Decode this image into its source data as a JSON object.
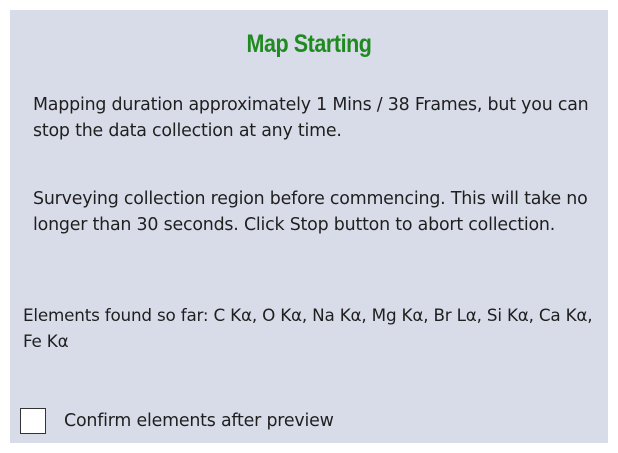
{
  "dialog": {
    "title": "Map Starting",
    "duration_text": "Mapping duration approximately 1 Mins  / 38 Frames, but you can stop the data collection at any time.",
    "survey_text": "Surveying collection region before commencing. This will take no longer than 30 seconds. Click Stop button to abort collection.",
    "elements_text": "Elements found so far: C  Kα, O  Kα, Na Kα, Mg Kα, Br Lα, Si Kα, Ca Kα, Fe Kα",
    "confirm_checkbox": {
      "label": "Confirm elements after preview",
      "checked": false
    }
  },
  "colors": {
    "panel_background": "#d8dce9",
    "title": "#1f8a1f",
    "text": "#1f1f1f"
  }
}
